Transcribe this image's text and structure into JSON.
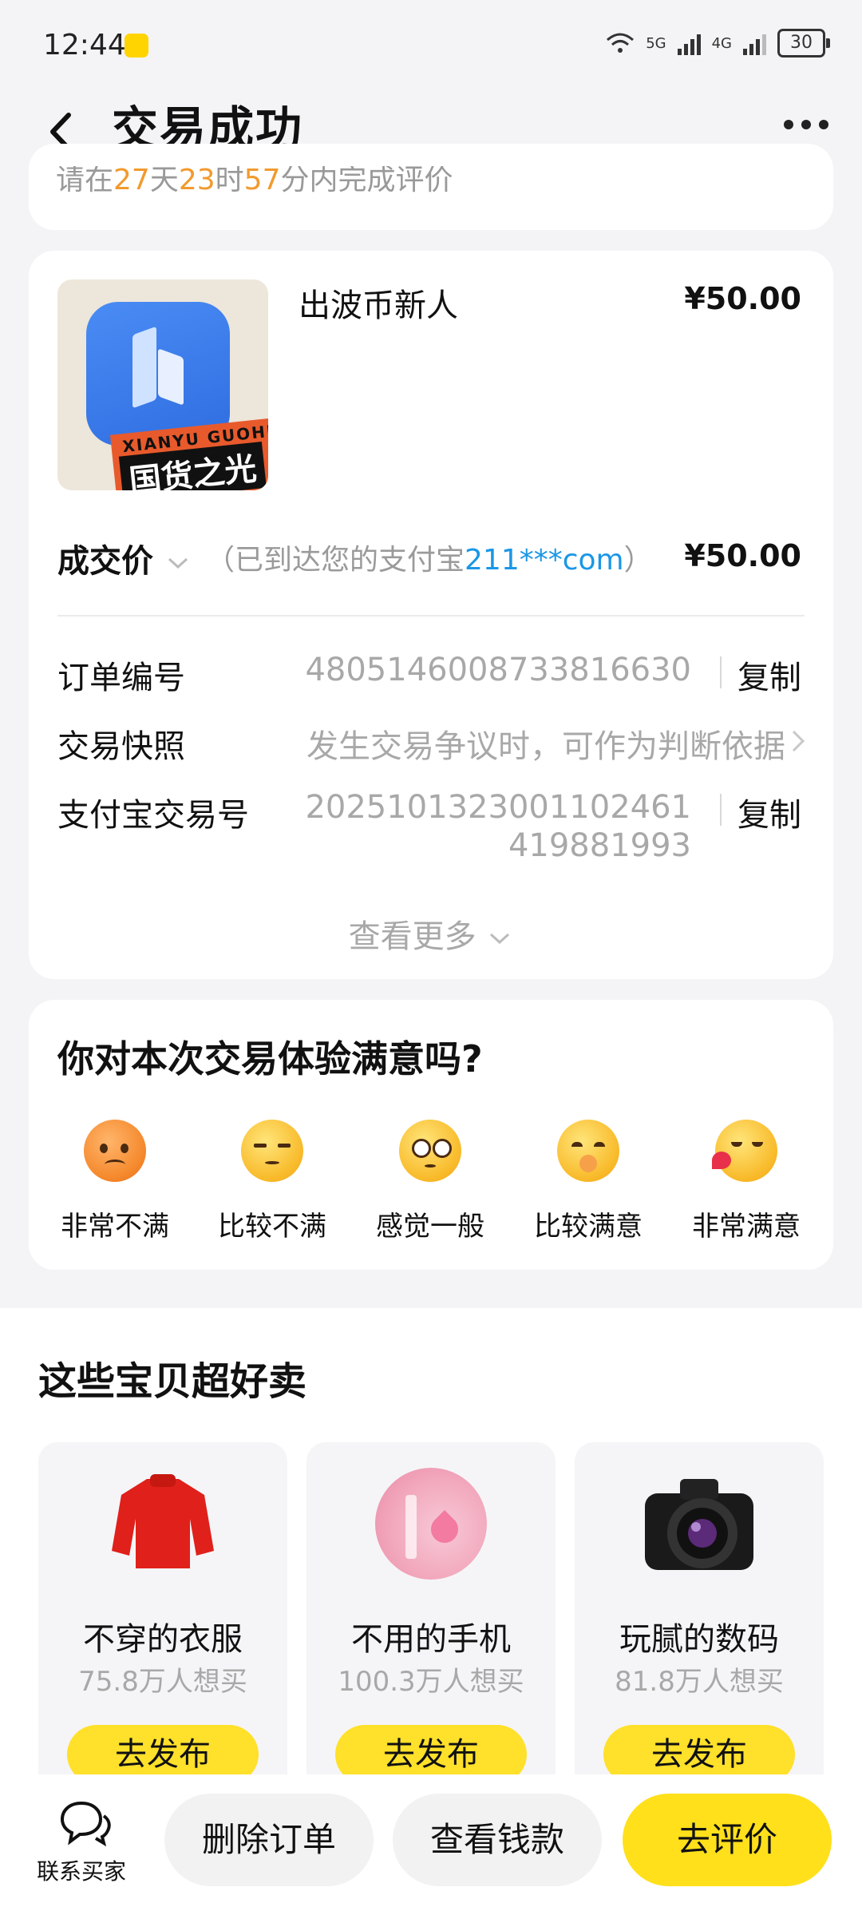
{
  "status_bar": {
    "time": "12:44",
    "badge": "闲鱼",
    "net1": "5G",
    "net2": "4G",
    "battery": "30"
  },
  "header": {
    "title": "交易成功"
  },
  "partial_reminder": {
    "prefix": "请在",
    "d": "27",
    "d_unit": "天",
    "h": "23",
    "h_unit": "时",
    "m": "57",
    "suffix": "分内完成评价"
  },
  "product": {
    "name": "出波币新人",
    "price": "¥50.00",
    "banner_text_1": "XIANYU GUOHUO",
    "banner_text_2": "国货之光"
  },
  "deal": {
    "label": "成交价",
    "note_prefix": "（已到达您的支付宝",
    "account": "211***com",
    "note_suffix": "）",
    "price": "¥50.00"
  },
  "rows": {
    "order_label": "订单编号",
    "order_value": "4805146008733816630",
    "snapshot_label": "交易快照",
    "snapshot_value": "发生交易争议时，可作为判断依据",
    "alipay_label": "支付宝交易号",
    "alipay_value_1": "2025101323001102461",
    "alipay_value_2": "419881993",
    "copy": "复制"
  },
  "see_more": "查看更多",
  "feedback": {
    "question": "你对本次交易体验满意吗?",
    "options": [
      "非常不满",
      "比较不满",
      "感觉一般",
      "比较满意",
      "非常满意"
    ]
  },
  "recommend": {
    "title": "这些宝贝超好卖",
    "items": [
      {
        "name": "不穿的衣服",
        "count": "75.8万人想买",
        "button": "去发布",
        "icon": "sweater-icon"
      },
      {
        "name": "不用的手机",
        "count": "100.3万人想买",
        "button": "去发布",
        "icon": "phone-icon"
      },
      {
        "name": "玩腻的数码",
        "count": "81.8万人想买",
        "button": "去发布",
        "icon": "camera-icon"
      }
    ]
  },
  "bottom": {
    "contact": "联系买家",
    "delete": "删除订单",
    "view_money": "查看钱款",
    "review": "去评价"
  },
  "colors": {
    "accent": "#ffe01b",
    "link": "#1a97e6",
    "orange": "#f29a2e"
  }
}
